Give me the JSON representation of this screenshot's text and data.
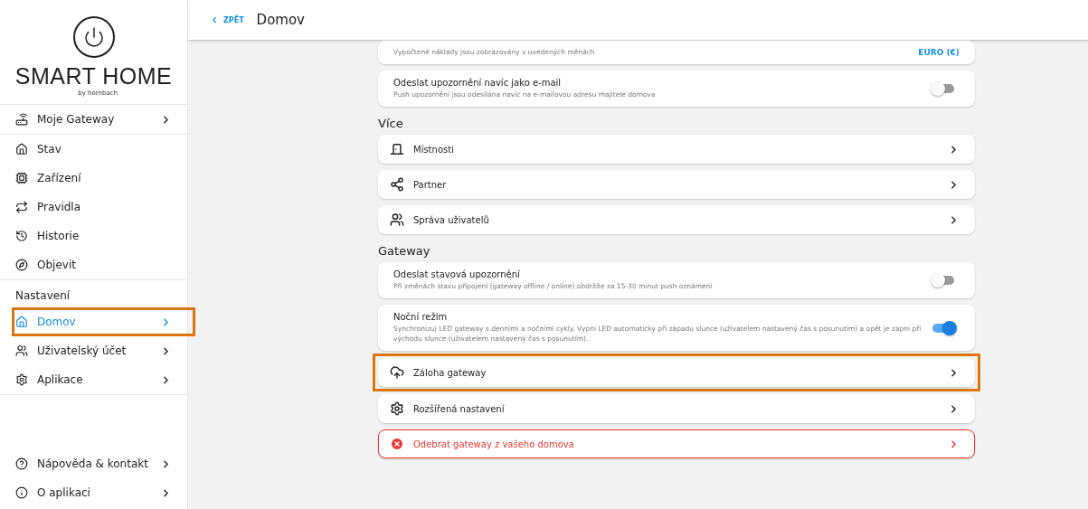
{
  "logo": {
    "title": "SMART HOME",
    "subtitle": "by hornbach"
  },
  "sidebar": {
    "groups": [
      {
        "items": [
          {
            "label": "Moje Gateway",
            "chevron": true,
            "selected": false,
            "highlighted": false
          }
        ]
      },
      {
        "items": [
          {
            "label": "Stav",
            "chevron": false,
            "selected": false,
            "highlighted": false
          },
          {
            "label": "Zařízení",
            "chevron": false,
            "selected": false,
            "highlighted": false
          },
          {
            "label": "Pravidla",
            "chevron": false,
            "selected": false,
            "highlighted": false
          },
          {
            "label": "Historie",
            "chevron": false,
            "selected": false,
            "highlighted": false
          },
          {
            "label": "Objevit",
            "chevron": false,
            "selected": false,
            "highlighted": false
          }
        ]
      },
      {
        "heading": "Nastavení",
        "items": [
          {
            "label": "Domov",
            "chevron": true,
            "selected": true,
            "highlighted": true
          },
          {
            "label": "Uživatelský účet",
            "chevron": true,
            "selected": false,
            "highlighted": false
          },
          {
            "label": "Aplikace",
            "chevron": true,
            "selected": false,
            "highlighted": false
          }
        ]
      }
    ],
    "footer": [
      {
        "label": "Nápověda & kontakt",
        "chevron": true,
        "selected": false,
        "highlighted": false
      },
      {
        "label": "O aplikaci",
        "chevron": true,
        "selected": false,
        "highlighted": false
      }
    ]
  },
  "header": {
    "back": "ZPĚT",
    "title": "Domov"
  },
  "sections": [
    {
      "items": [
        {
          "kind": "setting",
          "description": "Vypočtené náklady jsou zobrazovány v uvedených měnách",
          "value": "EURO (€)",
          "highlighted": false
        },
        {
          "kind": "toggle",
          "title": "Odeslat upozornění navíc jako e-mail",
          "description": "Push upozornění jsou odesílána navíc na e-mailovou adresu majitele domova",
          "on": false,
          "highlighted": false
        }
      ]
    },
    {
      "heading": "Více",
      "items": [
        {
          "kind": "link",
          "title": "Místnosti",
          "highlighted": false
        },
        {
          "kind": "link",
          "title": "Partner",
          "highlighted": false
        },
        {
          "kind": "link",
          "title": "Správa uživatelů",
          "highlighted": false
        }
      ]
    },
    {
      "heading": "Gateway",
      "items": [
        {
          "kind": "toggle",
          "title": "Odeslat stavová upozornění",
          "description": "Při změnách stavu připojení (gateway offline / online) obdržíte za 15-30 minut push oznámení",
          "on": false,
          "highlighted": false
        },
        {
          "kind": "toggle",
          "title": "Noční režim",
          "description": "Synchronizuj LED gateway s denními a nočními cykly. Vypni LED automaticky při západu slunce (uživatelem nastavený čas s posunutím) a opět je zapni při východu slunce (uživatelem nastavený čas s posunutím).",
          "on": true,
          "highlighted": false
        },
        {
          "kind": "link",
          "title": "Záloha gateway",
          "highlighted": true
        },
        {
          "kind": "link",
          "title": "Rozšířená nastavení",
          "highlighted": false
        },
        {
          "kind": "danger",
          "title": "Odebrat gateway z vašeho domova",
          "highlighted": false
        }
      ]
    }
  ]
}
